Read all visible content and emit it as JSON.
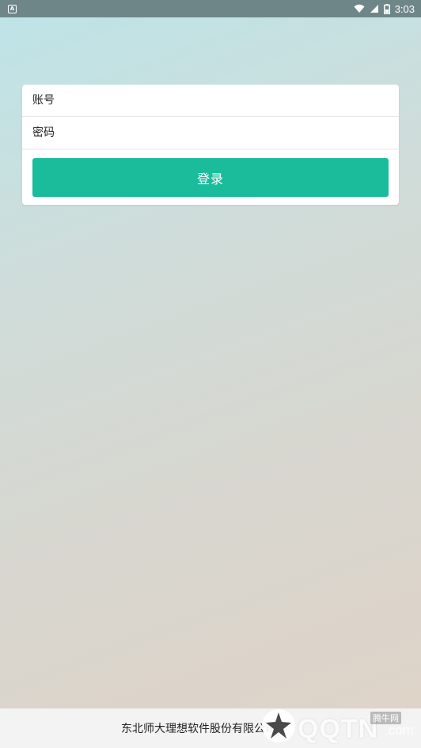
{
  "status_bar": {
    "notification_icon": "A",
    "time": "3:03",
    "icons": [
      "wifi-icon",
      "signal-icon",
      "battery-icon"
    ]
  },
  "login": {
    "account_placeholder": "账号",
    "password_placeholder": "密码",
    "button_label": "登录",
    "button_color": "#1abc9c"
  },
  "footer": {
    "company": "东北师大理想软件股份有限公司"
  },
  "watermark": {
    "brand": "QQTN",
    "domain": ".com",
    "chinese": "腾牛网"
  }
}
